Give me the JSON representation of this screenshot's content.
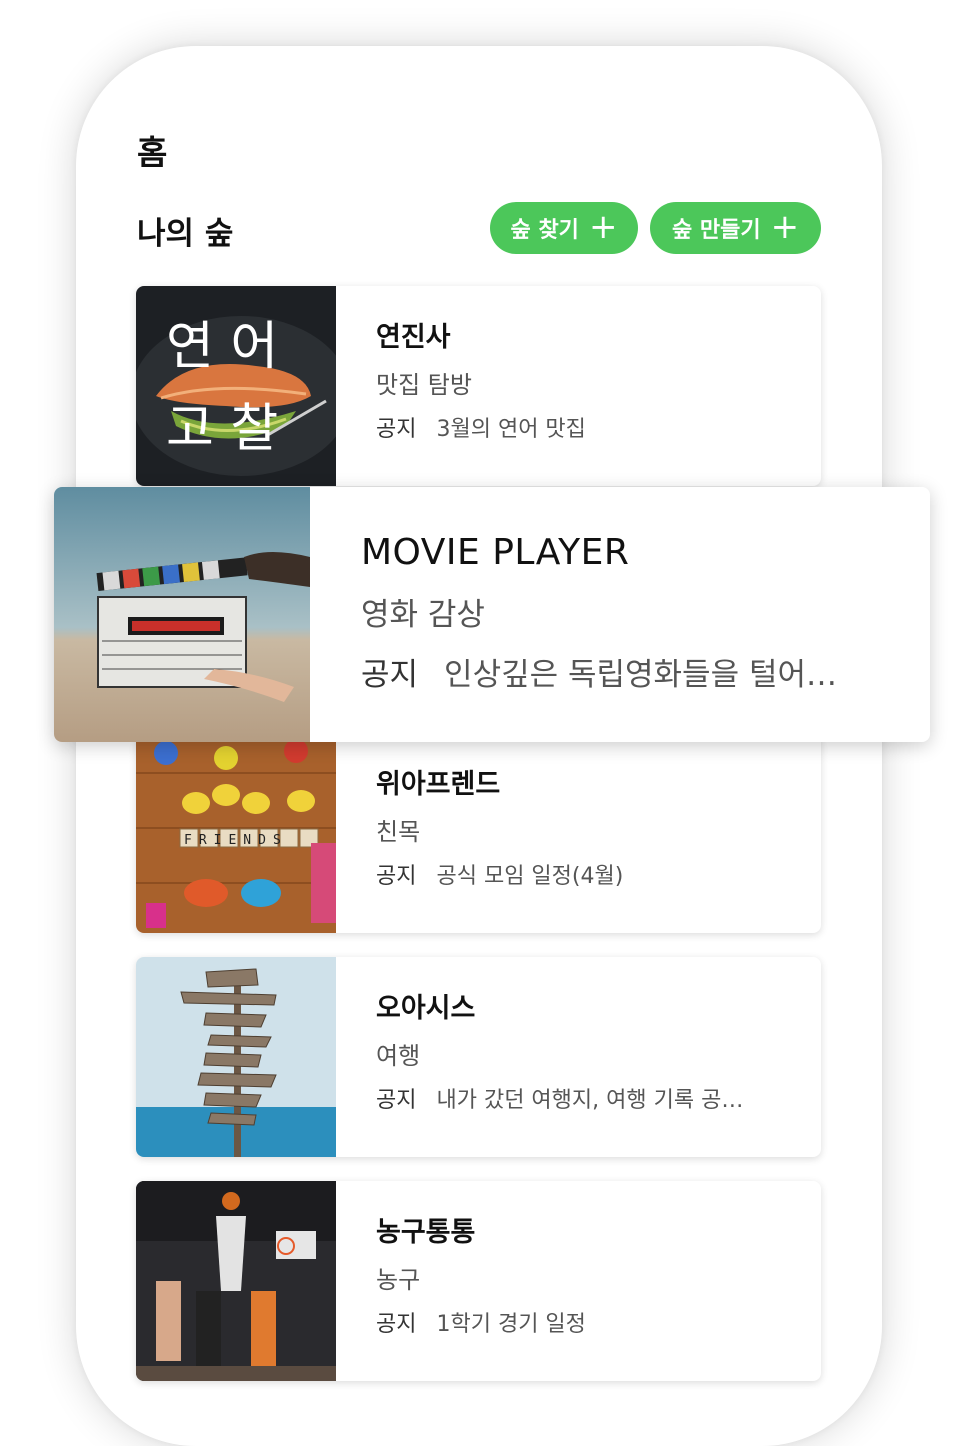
{
  "header": {
    "title": "홈"
  },
  "section": {
    "title": "나의 숲",
    "find_button": "숲 찾기",
    "create_button": "숲 만들기"
  },
  "notice_label": "공지",
  "thumbnail_overlay": {
    "salmon": "연 어\n고 찰",
    "friends_tiles": "FRIENDS"
  },
  "forests": [
    {
      "name": "연진사",
      "category": "맛집 탐방",
      "notice": "3월의 연어 맛집",
      "thumb": "salmon-photo"
    },
    {
      "name": "MOVIE PLAYER",
      "category": "영화 감상",
      "notice": "인상깊은 독립영화들을 털어…",
      "thumb": "clapperboard-photo"
    },
    {
      "name": "위아프렌드",
      "category": "친목",
      "notice": "공식 모임 일정(4월)",
      "thumb": "friends-toys-photo"
    },
    {
      "name": "오아시스",
      "category": "여행",
      "notice": "내가 갔던 여행지, 여행 기록 공…",
      "thumb": "signpost-photo"
    },
    {
      "name": "농구통통",
      "category": "농구",
      "notice": "1학기 경기 일정",
      "thumb": "basketball-photo"
    }
  ],
  "colors": {
    "accent": "#4cc75a",
    "text": "#111111",
    "subtext": "#555555"
  }
}
